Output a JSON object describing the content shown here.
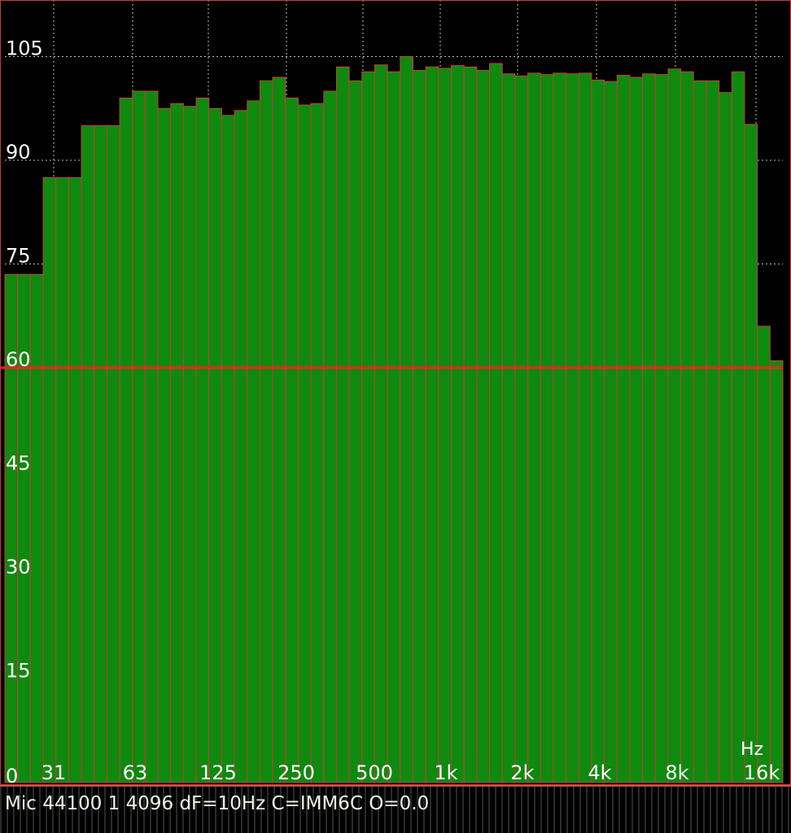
{
  "chart_data": {
    "type": "bar",
    "title": "",
    "xlabel": "Hz",
    "ylabel": "",
    "ylim": [
      0,
      112
    ],
    "y_ticks": [
      "105",
      "90",
      "75",
      "60",
      "45",
      "30",
      "15",
      "0"
    ],
    "y_tick_values": [
      105,
      90,
      75,
      60,
      45,
      30,
      15,
      0
    ],
    "x_tick_labels": [
      "31",
      "63",
      "125",
      "250",
      "500",
      "1k",
      "2k",
      "4k",
      "8k",
      "16k"
    ],
    "reference_level": 60,
    "grid": true,
    "values": [
      73.5,
      73.5,
      73.5,
      87.5,
      87.5,
      87.5,
      95,
      95,
      95,
      99,
      100,
      100,
      97.5,
      98.2,
      97.8,
      99,
      97.5,
      96.5,
      97.2,
      98.6,
      101.5,
      102,
      99,
      98,
      98.2,
      100,
      103.5,
      101.5,
      102.8,
      103.8,
      102.8,
      105,
      103,
      103.5,
      103.3,
      103.7,
      103.5,
      103,
      104,
      102.5,
      102.2,
      102.6,
      102.4,
      102.6,
      102.5,
      102.6,
      101.6,
      101.4,
      102.3,
      102,
      102.5,
      102.4,
      103.2,
      102.8,
      101.5,
      101.5,
      99.8,
      102.8,
      95.2,
      66,
      61
    ]
  },
  "colors": {
    "background": "#000000",
    "bar_fill": "#0e8a0e",
    "bar_edge": "#c83c3c",
    "reference_line": "#ff2020",
    "grid": "#bbbbbb",
    "text": "#ffffff"
  },
  "status": {
    "text": "Mic 44100 1 4096 dF=10Hz C=IMM6C O=0.0"
  }
}
